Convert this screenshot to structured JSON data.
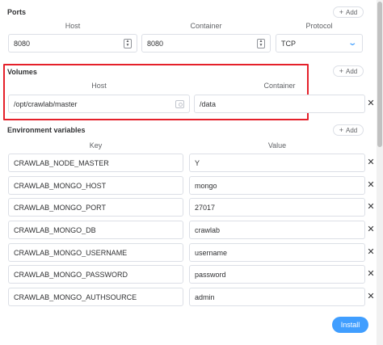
{
  "ports": {
    "title": "Ports",
    "add_label": "Add",
    "host_label": "Host",
    "container_label": "Container",
    "protocol_label": "Protocol",
    "host_value": "8080",
    "container_value": "8080",
    "protocol_value": "TCP"
  },
  "volumes": {
    "title": "Volumes",
    "add_label": "Add",
    "host_label": "Host",
    "container_label": "Container",
    "host_value": "/opt/crawlab/master",
    "container_value": "/data"
  },
  "env": {
    "title": "Environment variables",
    "add_label": "Add",
    "key_label": "Key",
    "value_label": "Value",
    "rows": [
      {
        "key": "CRAWLAB_NODE_MASTER",
        "value": "Y"
      },
      {
        "key": "CRAWLAB_MONGO_HOST",
        "value": "mongo"
      },
      {
        "key": "CRAWLAB_MONGO_PORT",
        "value": "27017"
      },
      {
        "key": "CRAWLAB_MONGO_DB",
        "value": "crawlab"
      },
      {
        "key": "CRAWLAB_MONGO_USERNAME",
        "value": "username"
      },
      {
        "key": "CRAWLAB_MONGO_PASSWORD",
        "value": "password"
      },
      {
        "key": "CRAWLAB_MONGO_AUTHSOURCE",
        "value": "admin"
      }
    ]
  },
  "footer": {
    "install_label": "Install"
  },
  "colors": {
    "primary": "#409eff",
    "highlight": "#e5202a",
    "border": "#dcdfe6"
  }
}
